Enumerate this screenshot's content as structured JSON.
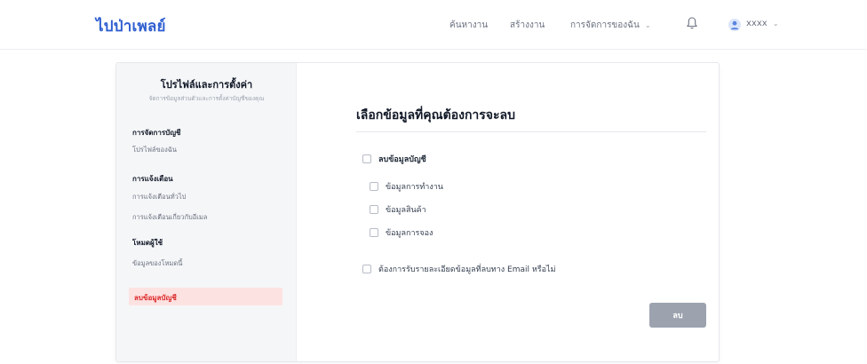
{
  "header": {
    "logo": "ไปป่าเพลย์",
    "nav": [
      {
        "label": "ค้นหางาน"
      },
      {
        "label": "สร้างงาน"
      },
      {
        "label": "การจัดการของฉัน"
      }
    ],
    "nav_caret": "⌄",
    "username": "xxxx",
    "user_caret": "⌄"
  },
  "sidebar": {
    "title": "โปรไฟล์และการตั้งค่า",
    "subtitle": "จัดการข้อมูลส่วนตัวและการตั้งค่าบัญชีของคุณ",
    "sections": [
      {
        "heading": "การจัดการบัญชี",
        "items": [
          "โปรไฟล์ของฉัน"
        ]
      },
      {
        "heading": "การแจ้งเตือน",
        "items": [
          "การแจ้งเตือนทั่วไป",
          "การแจ้งเตือนเกี่ยวกับอีเมล"
        ]
      },
      {
        "heading": "โหมดผู้ใช้",
        "items": [
          "ข้อมูลของโหมดนี้"
        ]
      }
    ],
    "danger_item": "ลบข้อมูลบัญชี"
  },
  "main": {
    "title": "เลือกข้อมูลที่คุณต้องการจะลบ",
    "account_option": "ลบข้อมูลบัญชี",
    "sub_options": [
      "ข้อมูลการทำงาน",
      "ข้อมูลสินค้า",
      "ข้อมูลการจอง"
    ],
    "email_option": "ต้องการรับรายละเอียดข้อมูลที่ลบทาง Email หรือไม่",
    "confirm_button": "ลบ"
  },
  "colors": {
    "brand": "#2f5fd0",
    "danger": "#dc2626",
    "danger_bg": "#fde2e2",
    "button_disabled": "#9ca3af"
  }
}
